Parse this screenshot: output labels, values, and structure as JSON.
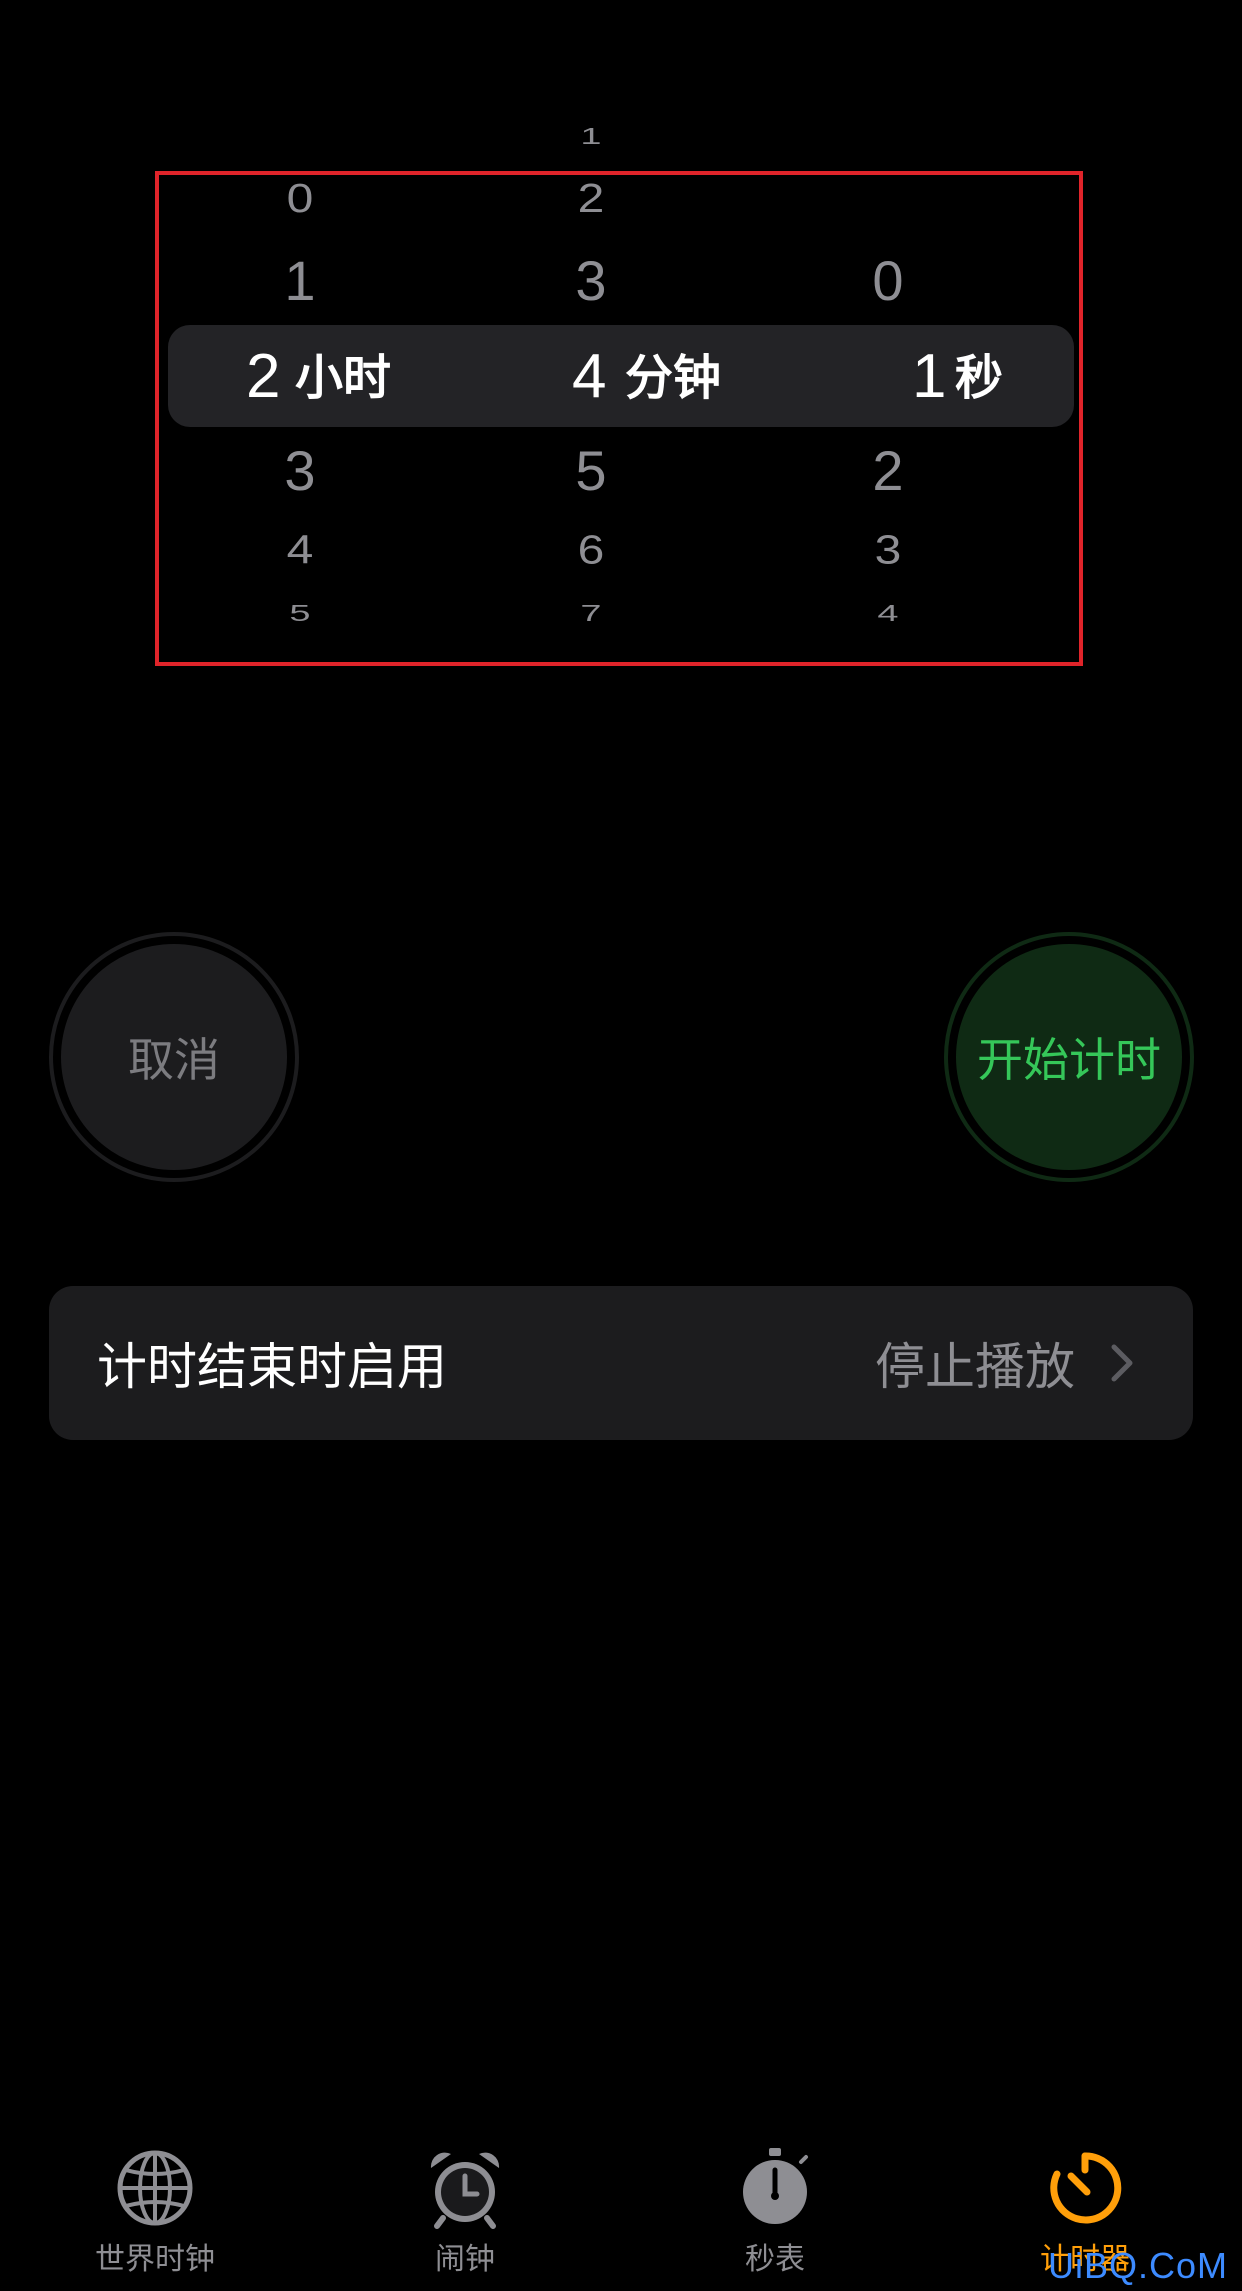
{
  "picker": {
    "hours": {
      "above": [
        "0",
        "1"
      ],
      "selected": "2",
      "unit": "小时",
      "below": [
        "3",
        "4",
        "5"
      ]
    },
    "minutes": {
      "above": [
        "1",
        "2",
        "3"
      ],
      "selected": "4",
      "unit": "分钟",
      "below": [
        "5",
        "6",
        "7"
      ]
    },
    "seconds": {
      "above": [
        "0"
      ],
      "selected": "1",
      "unit": "秒",
      "below": [
        "2",
        "3",
        "4"
      ]
    }
  },
  "buttons": {
    "cancel": "取消",
    "start": "开始计时"
  },
  "setting": {
    "label": "计时结束时启用",
    "value": "停止播放"
  },
  "tabs": [
    {
      "label": "世界时钟",
      "icon": "globe-icon",
      "active": false
    },
    {
      "label": "闹钟",
      "icon": "alarm-clock-icon",
      "active": false
    },
    {
      "label": "秒表",
      "icon": "stopwatch-icon",
      "active": false
    },
    {
      "label": "计时器",
      "icon": "timer-icon",
      "active": true
    }
  ],
  "colors": {
    "accent_active": "#ff9f0a",
    "start_green": "#35c759",
    "highlight_frame": "#e0242a"
  },
  "watermark": "UiBQ.CoM"
}
